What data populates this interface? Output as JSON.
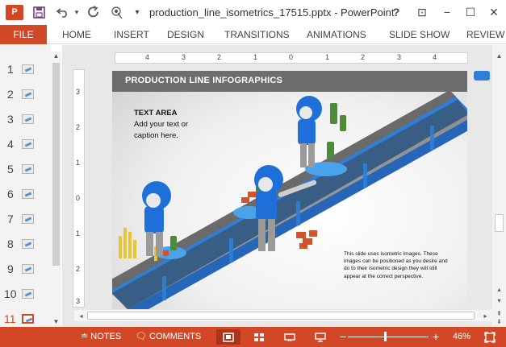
{
  "titlebar": {
    "app_badge": "P",
    "document_title": "production_line_isometrics_17515.pptx - PowerPoint",
    "qat_icons": [
      "save-icon",
      "undo-icon",
      "redo-icon",
      "touch-mode-icon",
      "customize-icon"
    ],
    "window_buttons": {
      "help": "?",
      "restore_ribbon": "⊡",
      "minimize": "−",
      "maximize": "☐",
      "close": "✕"
    }
  },
  "ribbon": {
    "file_label": "FILE",
    "tabs": [
      "HOME",
      "INSERT",
      "DESIGN",
      "TRANSITIONS",
      "ANIMATIONS",
      "SLIDE SHOW",
      "REVIEW"
    ]
  },
  "thumbnails": {
    "numbers": [
      "1",
      "2",
      "3",
      "4",
      "5",
      "6",
      "7",
      "8",
      "9",
      "10",
      "11"
    ],
    "active": "11"
  },
  "ruler": {
    "horizontal_labels": [
      "4",
      "3",
      "2",
      "1",
      "0",
      "1",
      "2",
      "3",
      "4"
    ],
    "vertical_labels": [
      "3",
      "2",
      "1",
      "0",
      "1",
      "2",
      "3"
    ]
  },
  "slide": {
    "header_title": "PRODUCTION LINE INFOGRAPHICS",
    "text_area_title": "TEXT AREA",
    "text_area_body": "Add your text or caption here.",
    "note": "This slide uses isometric images. These images can be positioned as you desire and do to their isometric design they will still appear at the correct perspective."
  },
  "statusbar": {
    "notes_label": "NOTES",
    "comments_label": "COMMENTS",
    "zoom_minus": "−",
    "zoom_plus": "+",
    "zoom_level": "46%",
    "zoom_fraction": 0.46
  },
  "colors": {
    "accent": "#d24726",
    "conveyor_blue": "#2e7fd8",
    "belt_gray": "#6a6a6a",
    "helmet_blue": "#1e6fd9"
  }
}
